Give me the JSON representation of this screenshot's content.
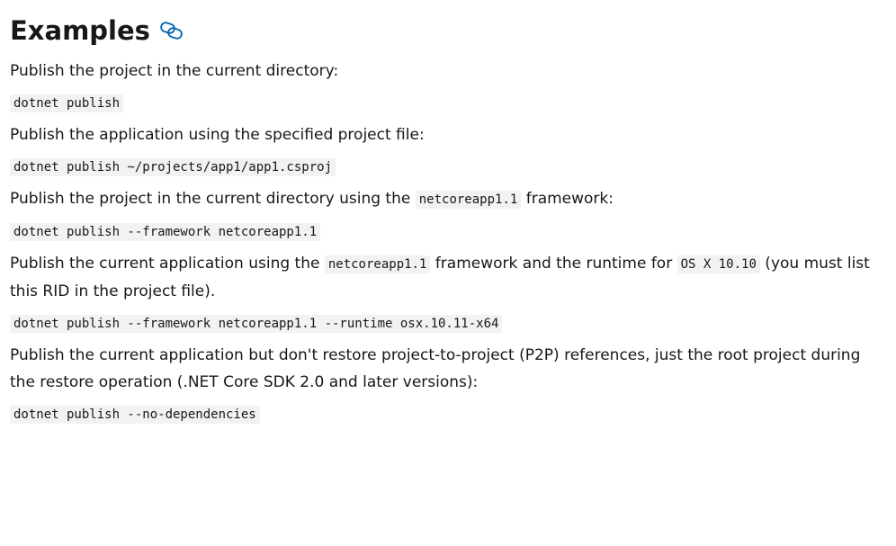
{
  "heading": "Examples",
  "icons": {
    "anchor": "link-icon",
    "accent": "#0065b3"
  },
  "examples": [
    {
      "text_parts": [
        "Publish the project in the current directory:"
      ],
      "command": "dotnet publish"
    },
    {
      "text_parts": [
        "Publish the application using the specified project file:"
      ],
      "command": "dotnet publish ~/projects/app1/app1.csproj"
    },
    {
      "text_parts": [
        "Publish the project in the current directory using the ",
        "netcoreapp1.1",
        " framework:"
      ],
      "command": "dotnet publish --framework netcoreapp1.1"
    },
    {
      "text_parts": [
        "Publish the current application using the ",
        "netcoreapp1.1",
        " framework and the runtime for ",
        "OS X 10.10",
        " (you must list this RID in the project file)."
      ],
      "command": "dotnet publish --framework netcoreapp1.1 --runtime osx.10.11-x64"
    },
    {
      "text_parts": [
        "Publish the current application but don't restore project-to-project (P2P) references, just the root project during the restore operation (.NET Core SDK 2.0 and later versions):"
      ],
      "command": "dotnet publish --no-dependencies"
    }
  ]
}
